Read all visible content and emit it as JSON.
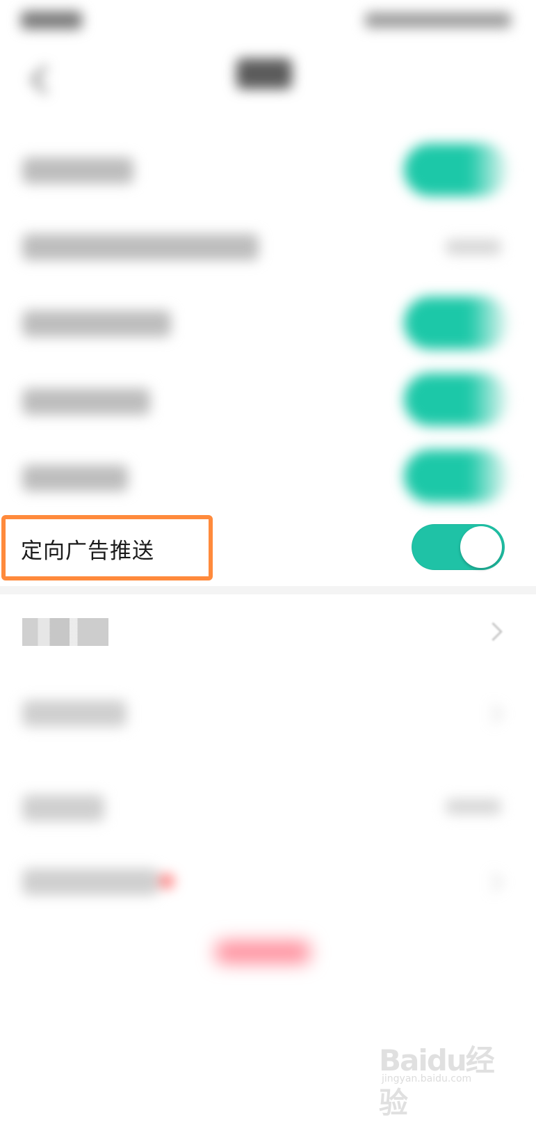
{
  "settings": {
    "targeted_ads_label": "定向广告推送",
    "targeted_ads_enabled": true
  },
  "colors": {
    "toggle_on": "#1fc2a6",
    "highlight": "#ff8a3c",
    "logout_text": "#ff6d7f"
  },
  "watermark": {
    "logo": "Baidu经验",
    "url": "jingyan.baidu.com"
  }
}
